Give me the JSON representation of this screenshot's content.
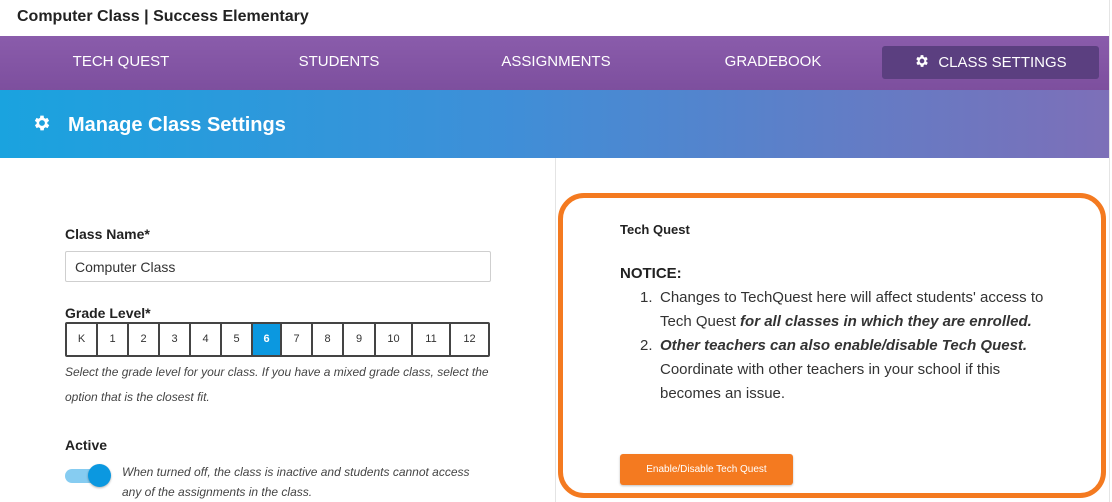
{
  "header": {
    "title": "Computer Class | Success Elementary"
  },
  "nav": {
    "items": [
      {
        "label": "TECH QUEST"
      },
      {
        "label": "STUDENTS"
      },
      {
        "label": "ASSIGNMENTS"
      },
      {
        "label": "GRADEBOOK"
      },
      {
        "label": "CLASS SETTINGS",
        "icon": "gear-icon",
        "active": true
      }
    ]
  },
  "banner": {
    "title": "Manage Class Settings",
    "icon": "gear-icon"
  },
  "form": {
    "class_name_label": "Class Name*",
    "class_name_value": "Computer Class",
    "grade_label": "Grade Level*",
    "grades": [
      "K",
      "1",
      "2",
      "3",
      "4",
      "5",
      "6",
      "7",
      "8",
      "9",
      "10",
      "11",
      "12"
    ],
    "selected_grade": "6",
    "grade_help": "Select the grade level for your class. If you have a mixed grade class, select the option that is the closest fit.",
    "active_label": "Active",
    "active_on": true,
    "active_help": "When turned off, the class is inactive and students cannot access any of the assignments in the class."
  },
  "tech_quest": {
    "title": "Tech Quest",
    "notice_heading": "NOTICE:",
    "notice_1_num": "1.",
    "notice_1_text": "Changes to TechQuest here will affect students' access to Tech Quest ",
    "notice_1_emph": "for all classes in which they are enrolled.",
    "notice_2_num": "2.",
    "notice_2_emph": "Other teachers can also enable/disable Tech Quest.",
    "notice_2_text": " Coordinate with other teachers in your school if this becomes an issue.",
    "button_label": "Enable/Disable Tech Quest"
  },
  "colors": {
    "nav_bg": "#8a5cab",
    "nav_active": "#5b3f80",
    "accent_blue": "#0b98e0",
    "highlight_orange": "#f47a20"
  }
}
